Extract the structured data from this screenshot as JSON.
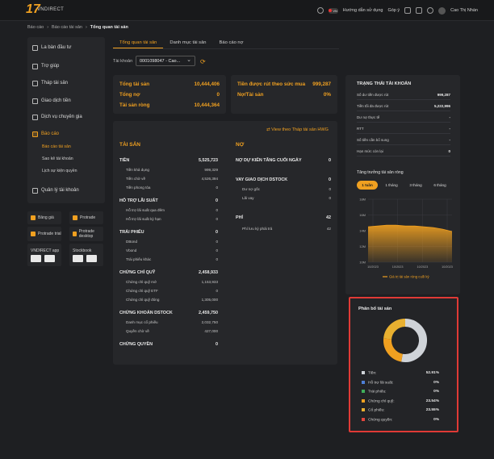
{
  "header": {
    "logo_text": "VNDIRECT",
    "lang": "VN",
    "guide": "Hướng dẫn sử dụng",
    "feedback": "Góp ý",
    "user_name": "Cao Thị Nhàn"
  },
  "breadcrumb": [
    "Báo cáo",
    "Báo cáo tài sản",
    "Tổng quan tài sản"
  ],
  "sidebar": {
    "items": [
      {
        "label": "La bàn đầu tư"
      },
      {
        "label": "Trợ giúp"
      },
      {
        "label": "Tháp tài sản"
      },
      {
        "label": "Giao dịch tiền"
      },
      {
        "label": "Dịch vụ chuyên gia"
      },
      {
        "label": "Báo cáo"
      },
      {
        "label": "Quản lý tài khoản"
      }
    ],
    "sub_items": [
      "Báo cáo tài sản",
      "Sao kê tài khoản",
      "Lịch sự kiện quyền"
    ],
    "tiles": [
      "Bảng giá",
      "Protrade",
      "Protrade trial",
      "Protrade desktop",
      "VNDIRECT app",
      "Stockbook"
    ]
  },
  "tabs": [
    "Tổng quan tài sản",
    "Danh mục tài sản",
    "Báo cáo nợ"
  ],
  "account": {
    "label": "Tài khoản",
    "value": "0001098047 - Cao..."
  },
  "summary": {
    "left": [
      {
        "k": "Tổng tài sản",
        "v": "10,444,406"
      },
      {
        "k": "Tổng nợ",
        "v": "0"
      },
      {
        "k": "Tài sản ròng",
        "v": "10,444,364"
      }
    ],
    "right": [
      {
        "k": "Tiền được rút theo sức mua",
        "v": "999,287"
      },
      {
        "k": "Nợ/Tài sản",
        "v": "0%"
      }
    ]
  },
  "main": {
    "hwg_link": "View theo Tháp tài sản HWG",
    "assets_title": "TÀI SẢN",
    "debt_title": "NỢ",
    "assets": [
      {
        "k": "TIỀN",
        "v": "5,525,723",
        "t": "b"
      },
      {
        "k": "Tiền khả dụng",
        "v": "999,329",
        "t": "s"
      },
      {
        "k": "Tiền chờ về",
        "v": "4,526,394",
        "t": "s"
      },
      {
        "k": "Tiền phong tỏa",
        "v": "0",
        "t": "s"
      },
      {
        "k": "HỖ TRỢ LÃI SUẤT",
        "v": "0",
        "t": "b"
      },
      {
        "k": "Hỗ trợ lãi suất qua đêm",
        "v": "0",
        "t": "s"
      },
      {
        "k": "Hỗ trợ lãi suất kỳ hạn",
        "v": "0",
        "t": "s"
      },
      {
        "k": "TRÁI PHIẾU",
        "v": "0",
        "t": "b"
      },
      {
        "k": "DBond",
        "v": "0",
        "t": "s"
      },
      {
        "k": "Vbond",
        "v": "0",
        "t": "s"
      },
      {
        "k": "Trái phiếu khác",
        "v": "0",
        "t": "s"
      },
      {
        "k": "CHỨNG CHỈ QUỸ",
        "v": "2,458,933",
        "t": "b"
      },
      {
        "k": "Chứng chỉ quỹ mở",
        "v": "1,153,933",
        "t": "s"
      },
      {
        "k": "Chứng chỉ quỹ ETF",
        "v": "0",
        "t": "s"
      },
      {
        "k": "Chứng chỉ quỹ đóng",
        "v": "1,305,000",
        "t": "s"
      },
      {
        "k": "CHỨNG KHOÁN DSTOCK",
        "v": "2,459,750",
        "t": "b"
      },
      {
        "k": "Danh mục cổ phiếu",
        "v": "2,032,750",
        "t": "s"
      },
      {
        "k": "Quyền chờ về",
        "v": "427,000",
        "t": "s"
      },
      {
        "k": "CHỨNG QUYỀN",
        "v": "0",
        "t": "b"
      }
    ],
    "debts": [
      {
        "k": "NỢ DỰ KIẾN TĂNG CUỐI NGÀY",
        "v": "0",
        "t": "b"
      },
      {
        "k": "VAY GIAO DỊCH DSTOCK",
        "v": "0",
        "t": "b"
      },
      {
        "k": "Dư nợ gốc",
        "v": "0",
        "t": "s"
      },
      {
        "k": "Lãi vay",
        "v": "0",
        "t": "s"
      },
      {
        "k": "PHÍ",
        "v": "42",
        "t": "b"
      },
      {
        "k": "Phí lưu ký phải trả",
        "v": "42",
        "t": "s"
      }
    ]
  },
  "status": {
    "title": "TRẠNG THÁI TÀI KHOẢN",
    "rows": [
      {
        "k": "Số dư tiền được rút",
        "v": "999,287"
      },
      {
        "k": "Tiền tối đa được rút",
        "v": "5,222,996"
      },
      {
        "k": "Dư nợ thực tế",
        "v": "-"
      },
      {
        "k": "RTT",
        "v": "-"
      },
      {
        "k": "Số tiền cần bổ sung",
        "v": "-"
      },
      {
        "k": "Hạn mức còn lại",
        "v": "0"
      }
    ],
    "growth_title": "Tăng trưởng tài sản ròng",
    "periods": [
      "1 tuần",
      "1 tháng",
      "3 tháng",
      "6 tháng"
    ],
    "legend": "Giá trị tài sản ròng cuối kỳ"
  },
  "chart_data": {
    "type": "area",
    "x": [
      "10/2023",
      "10/2023",
      "10/2023",
      "10/2023"
    ],
    "y_ticks": [
      "18M",
      "16M",
      "14M",
      "12M",
      "10M"
    ],
    "ylim": [
      10,
      18
    ],
    "values": [
      14.5,
      14.6,
      14.7,
      14.7,
      14.6,
      14.6,
      14.5,
      14.4,
      14.2,
      13.9
    ],
    "color": "#f0a020"
  },
  "allocation": {
    "title": "Phân bổ tài sản",
    "items": [
      {
        "label": "Tiền:",
        "value": "52.91%",
        "pct": 52.91,
        "color": "#cfd3d8"
      },
      {
        "label": "Hỗ trợ lãi suất:",
        "value": "0%",
        "pct": 0,
        "color": "#4e7fd6"
      },
      {
        "label": "Trái phiếu:",
        "value": "0%",
        "pct": 0,
        "color": "#3fae5a"
      },
      {
        "label": "Chứng chỉ quỹ:",
        "value": "23.54%",
        "pct": 23.54,
        "color": "#f0a020"
      },
      {
        "label": "Cổ phiếu:",
        "value": "23.55%",
        "pct": 23.55,
        "color": "#e8b030"
      },
      {
        "label": "Chứng quyền:",
        "value": "0%",
        "pct": 0,
        "color": "#e0463e"
      }
    ]
  }
}
